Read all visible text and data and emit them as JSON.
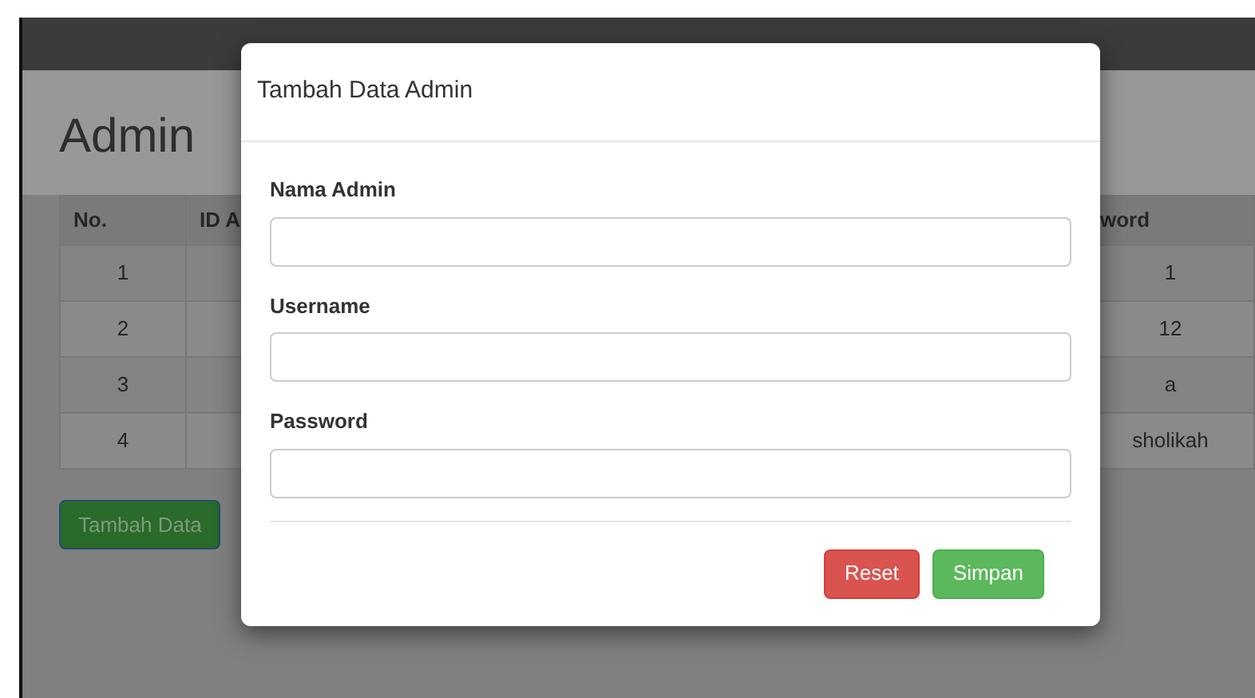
{
  "page": {
    "heading": "Admin"
  },
  "table": {
    "columns": [
      "No.",
      "ID A",
      "word"
    ],
    "rows": [
      {
        "cells": [
          "1",
          "1"
        ]
      },
      {
        "cells": [
          "2",
          "12"
        ]
      },
      {
        "cells": [
          "3",
          "a"
        ]
      },
      {
        "cells": [
          "4",
          "sholikah"
        ]
      }
    ]
  },
  "add_button": {
    "label": "Tambah Data"
  },
  "modal": {
    "title": "Tambah Data Admin",
    "fields": [
      {
        "label": "Nama Admin"
      },
      {
        "label": "Username"
      },
      {
        "label": "Password"
      }
    ],
    "buttons": [
      {
        "label": "Reset",
        "kind": "danger"
      },
      {
        "label": "Simpan",
        "kind": "success"
      }
    ]
  }
}
